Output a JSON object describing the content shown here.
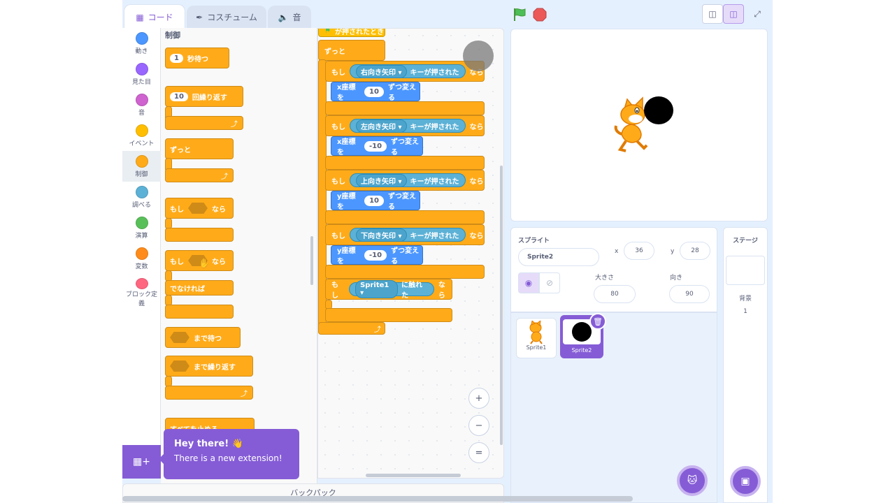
{
  "tabs": [
    {
      "label": "コード",
      "icon": "code-icon"
    },
    {
      "label": "コスチューム",
      "icon": "brush-icon"
    },
    {
      "label": "音",
      "icon": "speaker-icon"
    }
  ],
  "categories": [
    {
      "label": "動き",
      "color": "#4c97ff"
    },
    {
      "label": "見た目",
      "color": "#9966ff"
    },
    {
      "label": "音",
      "color": "#cf63cf"
    },
    {
      "label": "イベント",
      "color": "#ffbf00"
    },
    {
      "label": "制御",
      "color": "#ffab19"
    },
    {
      "label": "調べる",
      "color": "#5cb1d6"
    },
    {
      "label": "演算",
      "color": "#59c059"
    },
    {
      "label": "変数",
      "color": "#ff8c1a"
    },
    {
      "label": "ブロック定義",
      "color": "#ff6680"
    }
  ],
  "palette": {
    "title": "制御",
    "wait": {
      "num": "1",
      "text": "秒待つ"
    },
    "repeat": {
      "num": "10",
      "text": "回繰り返す"
    },
    "forever": "ずっと",
    "if_then": {
      "if": "もし",
      "then": "なら"
    },
    "if_else": {
      "if": "もし",
      "then": "なら",
      "else": "でなければ"
    },
    "wait_until": "まで待つ",
    "repeat_until": "まで繰り返す",
    "stop_all": "すべてを止める"
  },
  "script": {
    "hat": "が押されたとき",
    "forever": "ずっと",
    "if_blocks": [
      {
        "if": "もし",
        "key": "右向き矢印",
        "pressed": "キーが押された",
        "then": "なら",
        "axis": "x座標を",
        "value": "10",
        "change": "ずつ変える"
      },
      {
        "if": "もし",
        "key": "左向き矢印",
        "pressed": "キーが押された",
        "then": "なら",
        "axis": "x座標を",
        "value": "-10",
        "change": "ずつ変える"
      },
      {
        "if": "もし",
        "key": "上向き矢印",
        "pressed": "キーが押された",
        "then": "なら",
        "axis": "y座標を",
        "value": "10",
        "change": "ずつ変える"
      },
      {
        "if": "もし",
        "key": "下向き矢印",
        "pressed": "キーが押された",
        "then": "なら",
        "axis": "y座標を",
        "value": "-10",
        "change": "ずつ変える"
      }
    ],
    "touch": {
      "if": "もし",
      "target": "Sprite1",
      "touched": "に触れた",
      "then": "なら"
    }
  },
  "zoom": {
    "in": "+",
    "out": "−",
    "reset": "="
  },
  "backpack": "バックパック",
  "sprite_info": {
    "sprite_label": "スプライト",
    "name": "Sprite2",
    "x_label": "x",
    "x": "36",
    "y_label": "y",
    "y": "28",
    "size_label": "大きさ",
    "size": "80",
    "direction_label": "向き",
    "direction": "90"
  },
  "sprites": [
    {
      "name": "Sprite1"
    },
    {
      "name": "Sprite2"
    }
  ],
  "stage_pane": {
    "title": "ステージ",
    "backdrop_label": "背景",
    "backdrop_count": "1"
  },
  "toast": {
    "title": "Hey there! 👋",
    "body": "There is a new extension!"
  }
}
